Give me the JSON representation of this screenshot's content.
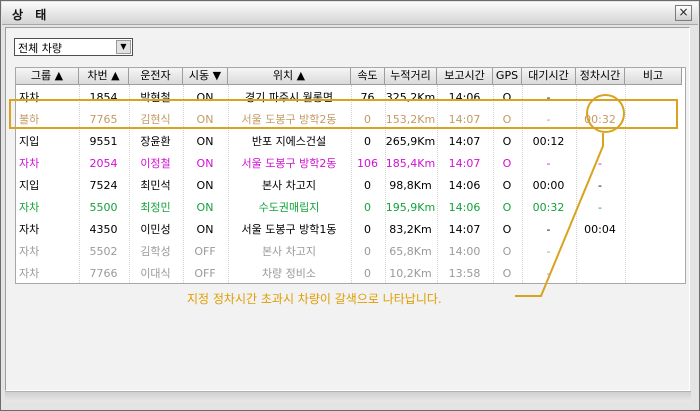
{
  "window": {
    "title": "상 태",
    "close_label": "×"
  },
  "filter": {
    "selected": "전체 차량",
    "arrow": "▼"
  },
  "columns": [
    {
      "key": "group",
      "label": "그룹 ▲"
    },
    {
      "key": "no",
      "label": "차번 ▲"
    },
    {
      "key": "driver",
      "label": "운전자"
    },
    {
      "key": "engine",
      "label": "시동 ▼"
    },
    {
      "key": "location",
      "label": "위치 ▲"
    },
    {
      "key": "speed",
      "label": "속도"
    },
    {
      "key": "distance",
      "label": "누적거리"
    },
    {
      "key": "report",
      "label": "보고시간"
    },
    {
      "key": "gps",
      "label": "GPS"
    },
    {
      "key": "wait",
      "label": "대기시간"
    },
    {
      "key": "stop",
      "label": "정차시간"
    },
    {
      "key": "remark",
      "label": "비고"
    }
  ],
  "rows": [
    {
      "color": "#000000",
      "cells": [
        "자차",
        "1854",
        "박현철",
        "ON",
        "경기 파주시 월롱면",
        "76",
        "325,2Km",
        "14:06",
        "O",
        "-",
        "",
        ""
      ]
    },
    {
      "color": "#c49a63",
      "cells": [
        "불하",
        "7765",
        "김현식",
        "ON",
        "서울 도봉구 방학2동",
        "0",
        "153,2Km",
        "14:07",
        "O",
        "-",
        "00:32",
        ""
      ]
    },
    {
      "color": "#000000",
      "cells": [
        "지입",
        "9551",
        "장윤환",
        "ON",
        "반포 지에스건설",
        "0",
        "265,9Km",
        "14:07",
        "O",
        "00:12",
        "",
        ""
      ]
    },
    {
      "color": "#d40fd4",
      "cells": [
        "자차",
        "2054",
        "이정철",
        "ON",
        "서울 도봉구 방학2동",
        "106",
        "185,4Km",
        "14:07",
        "O",
        "-",
        "-",
        ""
      ]
    },
    {
      "color": "#000000",
      "cells": [
        "지입",
        "7524",
        "최민석",
        "ON",
        "본사 차고지",
        "0",
        "98,8Km",
        "14:06",
        "O",
        "00:00",
        "-",
        ""
      ]
    },
    {
      "color": "#12a33a",
      "cells": [
        "자차",
        "5500",
        "최정민",
        "ON",
        "수도권매립지",
        "0",
        "195,9Km",
        "14:06",
        "O",
        "00:32",
        "-",
        ""
      ]
    },
    {
      "color": "#000000",
      "cells": [
        "자차",
        "4350",
        "이민성",
        "ON",
        "서울 도봉구 방학1동",
        "0",
        "83,2Km",
        "14:07",
        "O",
        "-",
        "00:04",
        ""
      ]
    },
    {
      "color": "#9a9a9a",
      "cells": [
        "자차",
        "5502",
        "김학성",
        "OFF",
        "본사 차고지",
        "0",
        "65,8Km",
        "14:00",
        "O",
        "-",
        "",
        ""
      ]
    },
    {
      "color": "#9a9a9a",
      "cells": [
        "자차",
        "7766",
        "이대식",
        "OFF",
        "차량 정비소",
        "0",
        "10,2Km",
        "13:58",
        "O",
        "-",
        "",
        ""
      ]
    }
  ],
  "annotation": {
    "text": "지정 정차시간 초과시 차량이 갈색으로 나타납니다.",
    "color": "#d9a21f"
  }
}
